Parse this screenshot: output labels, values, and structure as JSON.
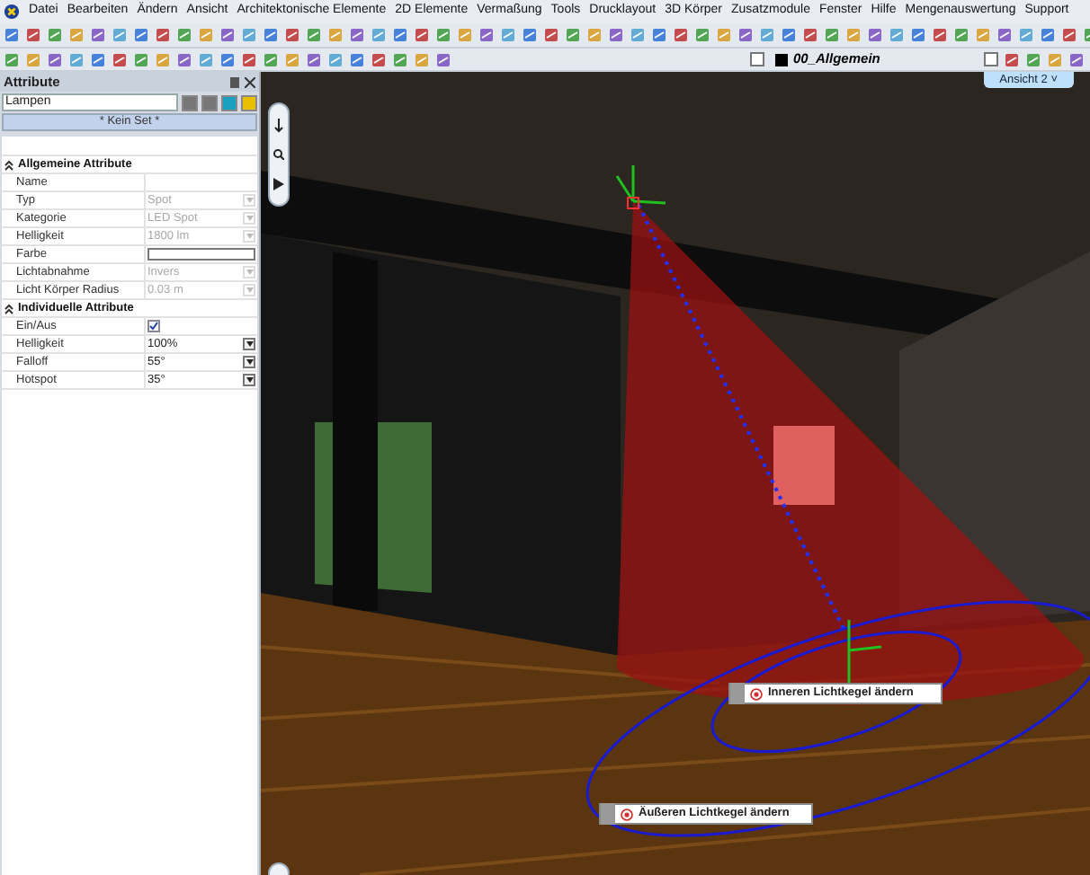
{
  "menu": [
    "Datei",
    "Bearbeiten",
    "Ändern",
    "Ansicht",
    "Architektonische Elemente",
    "2D Elemente",
    "Vermaßung",
    "Tools",
    "Drucklayout",
    "3D Körper",
    "Zusatzmodule",
    "Fenster",
    "Hilfe",
    "Mengenauswertung",
    "Support"
  ],
  "layer_field": {
    "value": "00_Allgemein"
  },
  "panel": {
    "title": "Attribute",
    "object_type": "Lampen",
    "set_label": "* Kein Set *",
    "sections": [
      {
        "title": "Allgemeine Attribute",
        "expanded": true,
        "rows": [
          {
            "label": "Name",
            "kind": "text"
          },
          {
            "label": "Typ",
            "kind": "dropdown",
            "value": "Spot",
            "disabled": true
          },
          {
            "label": "Kategorie",
            "kind": "dropdown",
            "value": "LED Spot",
            "disabled": true
          },
          {
            "label": "Helligkeit",
            "kind": "dropdown",
            "value": "1800 lm",
            "disabled": true
          },
          {
            "label": "Farbe",
            "kind": "color"
          },
          {
            "label": "Lichtabnahme",
            "kind": "dropdown",
            "value": "Invers",
            "disabled": true
          },
          {
            "label": "Licht Körper Radius",
            "kind": "dropdown",
            "value": "0.03 m",
            "disabled": true
          }
        ]
      },
      {
        "title": "Individuelle Attribute",
        "expanded": true,
        "rows": [
          {
            "label": "Ein/Aus",
            "kind": "checkbox",
            "checked": true
          },
          {
            "label": "Helligkeit",
            "kind": "dropdown",
            "value": "100%",
            "disabled": false
          },
          {
            "label": "Falloff",
            "kind": "dropdown",
            "value": "55°",
            "disabled": false
          },
          {
            "label": "Hotspot",
            "kind": "dropdown",
            "value": "35°",
            "disabled": false
          }
        ]
      }
    ]
  },
  "view_tab": {
    "label": "Ansicht 2 ˅",
    "selected": true
  },
  "scene_labels": [
    {
      "text": "Inneren Lichtkegel ändern"
    },
    {
      "text": "Äußeren Lichtkegel ändern"
    }
  ]
}
